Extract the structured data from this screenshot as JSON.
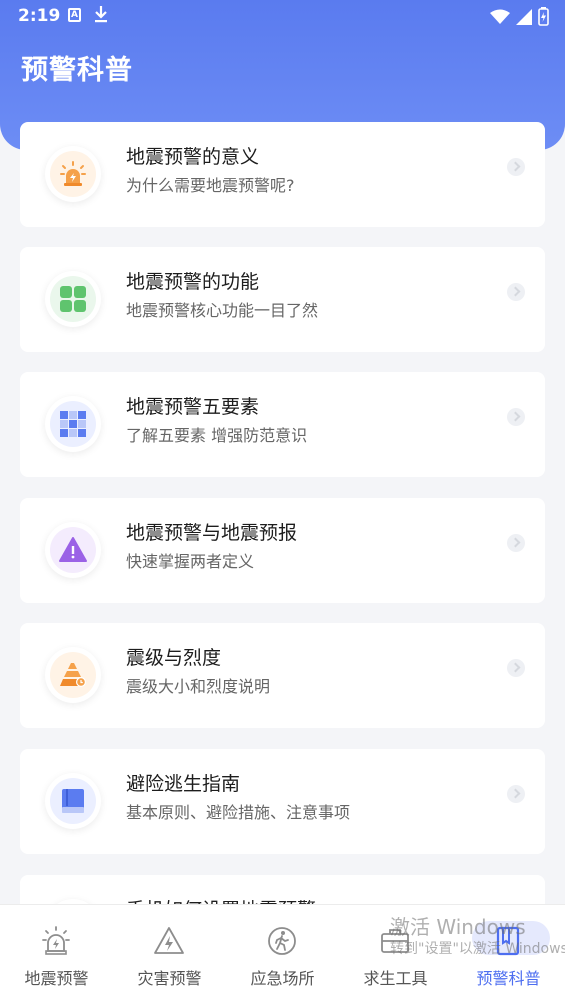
{
  "status_bar": {
    "time": "2:19",
    "notif_a": "A"
  },
  "header": {
    "title": "预警科普"
  },
  "cards": [
    {
      "title": "地震预警的意义",
      "subtitle": "为什么需要地震预警呢?",
      "icon": "alarm-siren-icon",
      "color": "#f5a14a"
    },
    {
      "title": "地震预警的功能",
      "subtitle": "地震预警核心功能一目了然",
      "icon": "grid-function-icon",
      "color": "#5fc46e"
    },
    {
      "title": "地震预警五要素",
      "subtitle": "了解五要素 增强防范意识",
      "icon": "checker-pattern-icon",
      "color": "#5b7cf0"
    },
    {
      "title": "地震预警与地震预报",
      "subtitle": "快速掌握两者定义",
      "icon": "warning-triangle-icon",
      "color": "#9b62e6"
    },
    {
      "title": "震级与烈度",
      "subtitle": "震级大小和烈度说明",
      "icon": "pyramid-scale-icon",
      "color": "#f5a14a"
    },
    {
      "title": "避险逃生指南",
      "subtitle": "基本原则、避险措施、注意事项",
      "icon": "book-icon",
      "color": "#5b7cf0"
    },
    {
      "title": "手机如何设置地震预警",
      "subtitle": "",
      "icon": "phone-icon",
      "color": "#5fc46e"
    }
  ],
  "tabs": [
    {
      "label": "地震预警",
      "icon": "siren-tab-icon",
      "active": false
    },
    {
      "label": "灾害预警",
      "icon": "lightning-triangle-icon",
      "active": false
    },
    {
      "label": "应急场所",
      "icon": "walking-person-icon",
      "active": false
    },
    {
      "label": "求生工具",
      "icon": "toolbox-icon",
      "active": false
    },
    {
      "label": "预警科普",
      "icon": "science-book-icon",
      "active": true
    }
  ],
  "watermark": {
    "line1": "激活 Windows",
    "line2": "转到\"设置\"以激活 Windows。"
  },
  "colors": {
    "accent": "#4d6ef0",
    "header_start": "#5a7bef",
    "header_end": "#6d8df5"
  }
}
